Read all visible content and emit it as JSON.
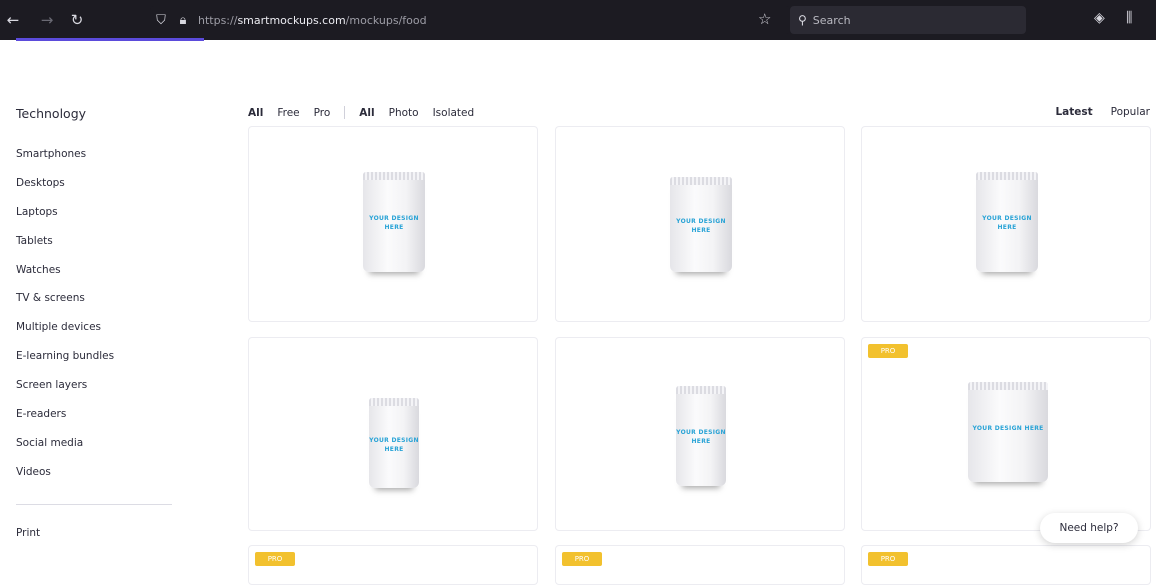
{
  "browser": {
    "url_prefix": "https://",
    "url_domain": "smartmockups.com",
    "url_path": "/mockups/food",
    "search_placeholder": "Search"
  },
  "sidebar": {
    "heading": "Technology",
    "items": [
      {
        "label": "Smartphones"
      },
      {
        "label": "Desktops"
      },
      {
        "label": "Laptops"
      },
      {
        "label": "Tablets"
      },
      {
        "label": "Watches"
      },
      {
        "label": "TV & screens"
      },
      {
        "label": "Multiple devices"
      },
      {
        "label": "E-learning bundles"
      },
      {
        "label": "Screen layers"
      },
      {
        "label": "E-readers"
      },
      {
        "label": "Social media"
      },
      {
        "label": "Videos"
      }
    ],
    "print_label": "Print"
  },
  "filters": {
    "pricing": [
      {
        "label": "All",
        "active": true
      },
      {
        "label": "Free",
        "active": false
      },
      {
        "label": "Pro",
        "active": false
      }
    ],
    "type": [
      {
        "label": "All",
        "active": true
      },
      {
        "label": "Photo",
        "active": false
      },
      {
        "label": "Isolated",
        "active": false
      }
    ]
  },
  "sort": [
    {
      "label": "Latest",
      "active": true
    },
    {
      "label": "Popular",
      "active": false
    }
  ],
  "mockups": [
    {
      "label": "YOUR DESIGN HERE",
      "pro": false
    },
    {
      "label": "YOUR DESIGN HERE",
      "pro": false
    },
    {
      "label": "YOUR DESIGN HERE",
      "pro": false
    },
    {
      "label": "YOUR DESIGN HERE",
      "pro": false
    },
    {
      "label": "YOUR DESIGN HERE",
      "pro": false
    },
    {
      "label": "YOUR DESIGN HERE",
      "pro": true
    },
    {
      "label": "",
      "pro": true
    },
    {
      "label": "",
      "pro": true
    },
    {
      "label": "",
      "pro": true
    }
  ],
  "badge_label": "PRO",
  "help_label": "Need help?",
  "colors": {
    "accent": "#5b4bdb",
    "pro_badge": "#f2c12e",
    "design_text": "#29a3d6"
  }
}
